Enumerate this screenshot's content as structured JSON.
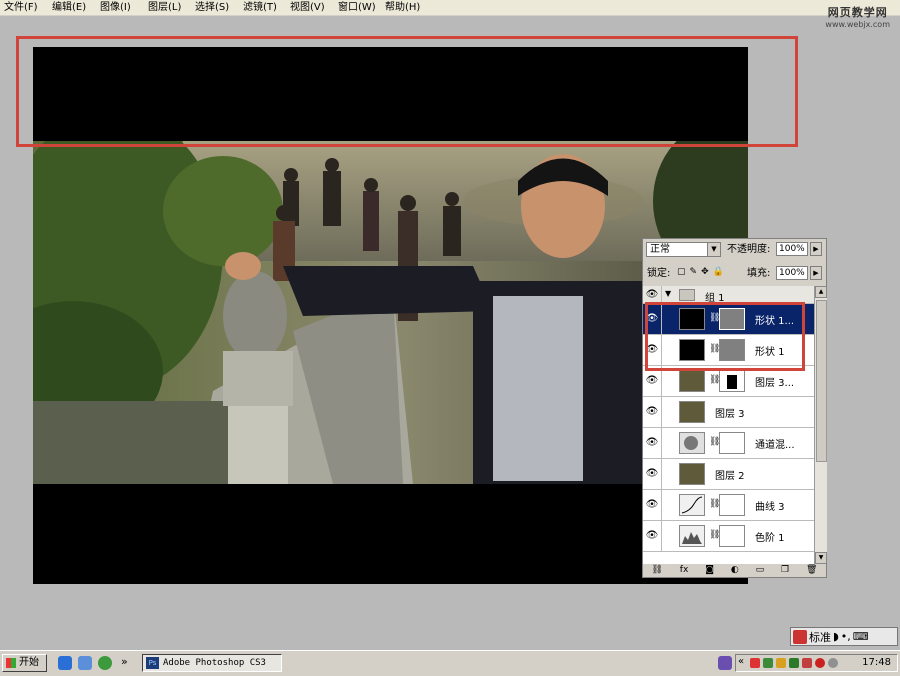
{
  "menu": [
    "文件(F)",
    "编辑(E)",
    "图像(I)",
    "图层(L)",
    "选择(S)",
    "滤镜(T)",
    "视图(V)",
    "窗口(W)",
    "帮助(H)"
  ],
  "watermark": {
    "title": "网页教学网",
    "url": "www.webjx.com"
  },
  "layers_panel": {
    "blend_mode": "正常",
    "opacity_label": "不透明度:",
    "opacity_value": "100%",
    "lock_label": "锁定:",
    "fill_label": "填充:",
    "fill_value": "100%",
    "group_name": "组 1",
    "layers": [
      {
        "name": "形状 1...",
        "selected": true
      },
      {
        "name": "形状 1",
        "selected": false
      },
      {
        "name": "图层 3...",
        "selected": false
      },
      {
        "name": "图层 3",
        "selected": false
      },
      {
        "name": "通道混...",
        "selected": false
      },
      {
        "name": "图层 2",
        "selected": false
      },
      {
        "name": "曲线 3",
        "selected": false
      },
      {
        "name": "色阶 1",
        "selected": false
      }
    ],
    "bottom_icons": [
      "link-icon",
      "fx-icon",
      "mask-icon",
      "adjustment-icon",
      "folder-icon",
      "new-layer-icon",
      "trash-icon"
    ]
  },
  "ime": {
    "mode": "标准"
  },
  "taskbar": {
    "start_label": "开始",
    "overflow": "»",
    "app_label": "Adobe Photoshop CS3",
    "clock": "17:48"
  },
  "colors": {
    "highlight_box": "#d0443a",
    "selected_layer": "#0a246a"
  }
}
